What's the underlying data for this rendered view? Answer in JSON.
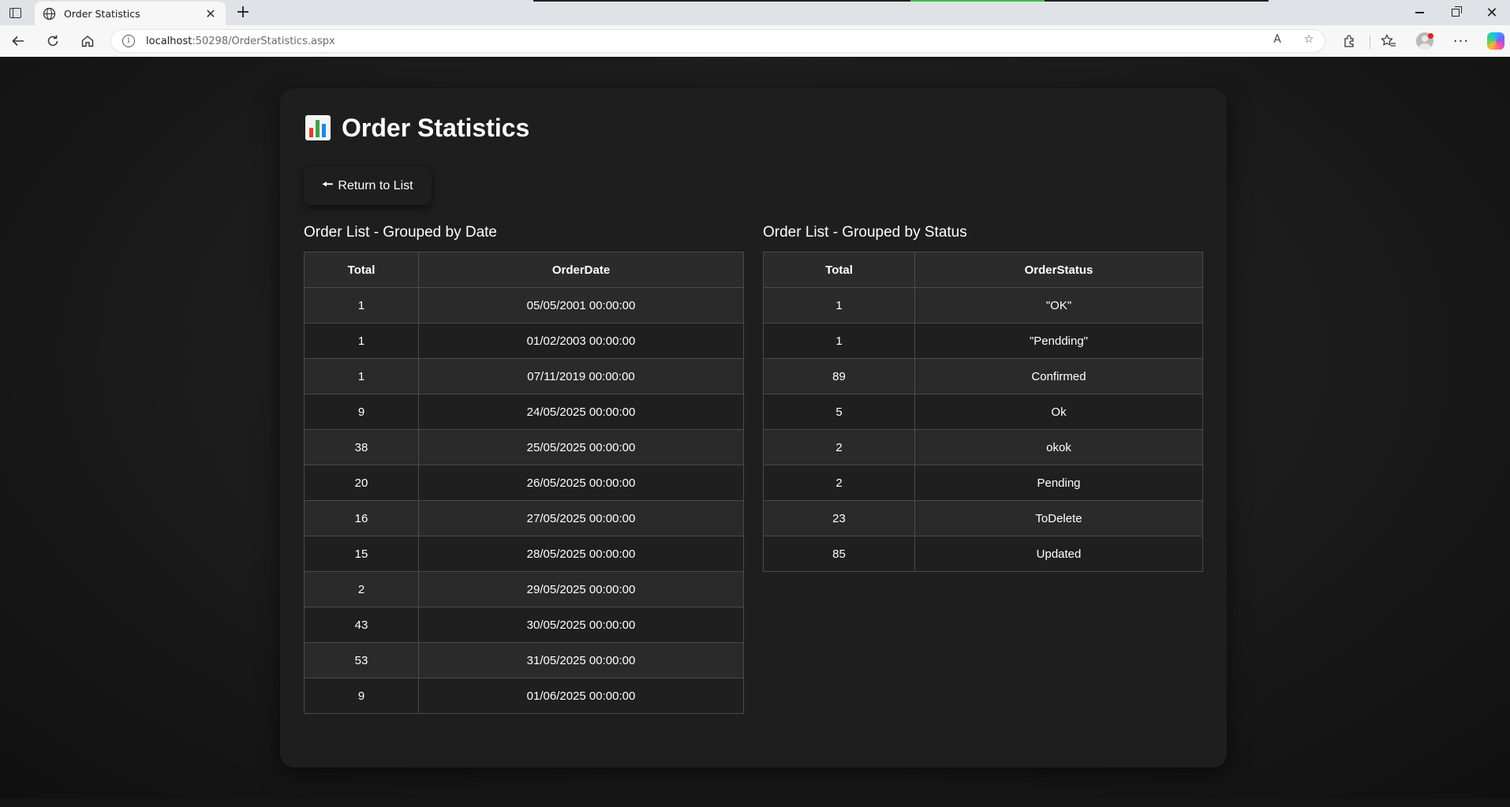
{
  "browser": {
    "tab_title": "Order Statistics",
    "tab_close": "✕",
    "new_tab": "+",
    "url_host": "localhost",
    "url_rest": ":50298/OrderStatistics.aspx",
    "win_close": "✕"
  },
  "page": {
    "title": "Order Statistics",
    "return_arrow": "🠔",
    "return_label": "Return to List"
  },
  "by_date": {
    "title": "Order List - Grouped by Date",
    "headers": [
      "Total",
      "OrderDate"
    ],
    "rows": [
      {
        "total": "1",
        "value": "05/05/2001 00:00:00"
      },
      {
        "total": "1",
        "value": "01/02/2003 00:00:00"
      },
      {
        "total": "1",
        "value": "07/11/2019 00:00:00"
      },
      {
        "total": "9",
        "value": "24/05/2025 00:00:00"
      },
      {
        "total": "38",
        "value": "25/05/2025 00:00:00"
      },
      {
        "total": "20",
        "value": "26/05/2025 00:00:00"
      },
      {
        "total": "16",
        "value": "27/05/2025 00:00:00"
      },
      {
        "total": "15",
        "value": "28/05/2025 00:00:00"
      },
      {
        "total": "2",
        "value": "29/05/2025 00:00:00"
      },
      {
        "total": "43",
        "value": "30/05/2025 00:00:00"
      },
      {
        "total": "53",
        "value": "31/05/2025 00:00:00"
      },
      {
        "total": "9",
        "value": "01/06/2025 00:00:00"
      }
    ]
  },
  "by_status": {
    "title": "Order List - Grouped by Status",
    "headers": [
      "Total",
      "OrderStatus"
    ],
    "rows": [
      {
        "total": "1",
        "value": "\"OK\""
      },
      {
        "total": "1",
        "value": "\"Pendding\""
      },
      {
        "total": "89",
        "value": "Confirmed"
      },
      {
        "total": "5",
        "value": "Ok"
      },
      {
        "total": "2",
        "value": "okok"
      },
      {
        "total": "2",
        "value": "Pending"
      },
      {
        "total": "23",
        "value": "ToDelete"
      },
      {
        "total": "85",
        "value": "Updated"
      }
    ]
  }
}
